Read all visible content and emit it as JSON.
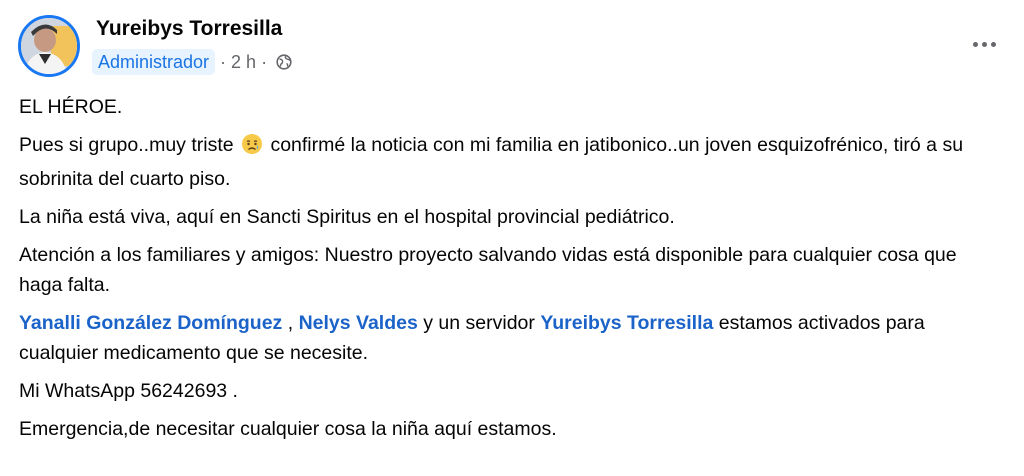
{
  "author": {
    "name": "Yureibys Torresilla",
    "role": "Administrador",
    "time": "2 h",
    "separator": "·",
    "privacy_icon": "globe-icon",
    "avatar_icon": "avatar"
  },
  "menu": {
    "icon": "more-horizontal-icon"
  },
  "post": {
    "line1": "EL HÉROE.",
    "p2_before": "Pues si grupo..muy triste",
    "p2_emoji": "sad-relieved-face-emoji",
    "p2_after": "confirmé la noticia con mi familia en jatibonico..un joven esquizofrénico, tiró a su sobrinita del cuarto piso.",
    "p3": "La niña está viva, aquí en Sancti Spiritus en el hospital provincial pediátrico.",
    "p4": "Atención a los familiares y amigos: Nuestro proyecto salvando vidas está disponible para cualquier cosa que haga falta.",
    "mention1": "Yanalli González Domínguez",
    "p5_sep": ",",
    "mention2": "Nelys Valdes",
    "p5_mid": "y un servidor",
    "mention3": "Yureibys Torresilla",
    "p5_after": "estamos activados para cualquier medicamento que se necesite.",
    "p6": "Mi WhatsApp 56242693 .",
    "p7": "Emergencia,de necesitar cualquier cosa la niña aquí estamos."
  },
  "colors": {
    "link": "#1b63c8",
    "badge_bg": "#e7f3ff",
    "badge_text": "#1b74e4",
    "meta_text": "#65676b",
    "avatar_ring": "#1877f2"
  }
}
